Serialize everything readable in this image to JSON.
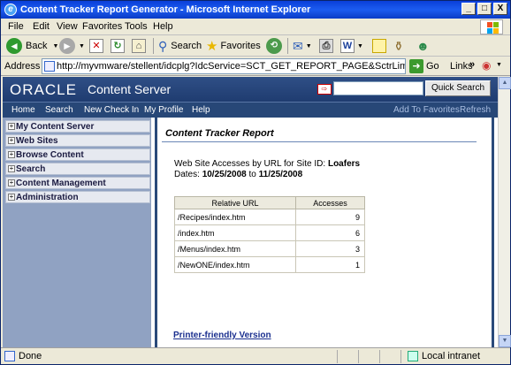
{
  "window": {
    "title": "Content Tracker Report Generator - Microsoft Internet Explorer",
    "minimize": "_",
    "maximize": "□",
    "close": "X"
  },
  "menubar": {
    "items": [
      "File",
      "Edit",
      "View",
      "Favorites",
      "Tools",
      "Help"
    ]
  },
  "toolbar": {
    "back": "Back",
    "search": "Search",
    "favorites": "Favorites"
  },
  "addressbar": {
    "label": "Address",
    "url": "http://myvmware/stellent/idcplg?IdcService=SCT_GET_REPORT_PAGE&SctrLimitReportSections=1&Sct",
    "go": "Go",
    "links": "Links",
    "chevron": "»"
  },
  "header": {
    "logo": "ORACLE",
    "product": "Content Server",
    "quick_search": "Quick Search",
    "search_value": ""
  },
  "nav": {
    "left": [
      "Home",
      "Search",
      "New Check In",
      "My Profile",
      "Help"
    ],
    "right": [
      "Add To Favorites",
      "Refresh"
    ]
  },
  "tray": {
    "items": [
      "My Content Server",
      "Web Sites",
      "Browse Content",
      "Search",
      "Content Management",
      "Administration"
    ]
  },
  "report": {
    "title": "Content Tracker Report",
    "desc_prefix": "Web Site Accesses by URL for Site ID: ",
    "site_id": "Loafers",
    "dates_prefix": "Dates: ",
    "date_from": "10/25/2008",
    "date_to_word": " to ",
    "date_to": "11/25/2008",
    "columns": [
      "Relative URL",
      "Accesses"
    ],
    "rows": [
      {
        "url": "/Recipes/index.htm",
        "accesses": "9"
      },
      {
        "url": "/index.htm",
        "accesses": "6"
      },
      {
        "url": "/Menus/index.htm",
        "accesses": "3"
      },
      {
        "url": "/NewONE/index.htm",
        "accesses": "1"
      }
    ],
    "printer_link": "Printer-friendly Version"
  },
  "status": {
    "text": "Done",
    "zone": "Local intranet"
  }
}
